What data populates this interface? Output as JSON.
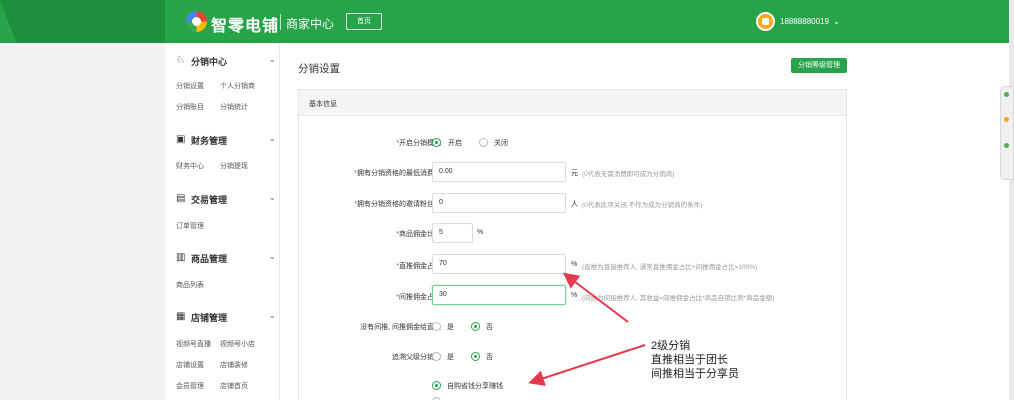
{
  "header": {
    "brand": "智零电铺",
    "subtitle": "商家中心",
    "home_label": "首页",
    "phone": "18888880019",
    "chevron": "⌄"
  },
  "sidebar": {
    "sections": [
      {
        "label": "分销中心",
        "icon": "share-icon",
        "glyph": "♘",
        "items": [
          "分销设置",
          "个人分销商",
          "分销账目",
          "分销统计"
        ]
      },
      {
        "label": "财务管理",
        "icon": "finance-icon",
        "glyph": "▣",
        "items": [
          "财务中心",
          "分销提现"
        ]
      },
      {
        "label": "交易管理",
        "icon": "order-icon",
        "glyph": "▤",
        "items": [
          "订单管理"
        ]
      },
      {
        "label": "商品管理",
        "icon": "goods-icon",
        "glyph": "▥",
        "items": [
          "商品列表"
        ]
      },
      {
        "label": "店铺管理",
        "icon": "store-icon",
        "glyph": "▦",
        "items": [
          "视频号直播",
          "视频号小店",
          "店铺设置",
          "店铺装修",
          "会员管理",
          "店铺首页"
        ]
      }
    ],
    "chevron": "⌄"
  },
  "main": {
    "title": "分销设置",
    "top_button": "分销等级管理",
    "panel_title": "基本信息",
    "form": {
      "enable_label": "开启分销模式",
      "opt_on": "开启",
      "opt_off": "关闭",
      "min_consume_label": "拥有分销资格的最低消费额",
      "min_consume_value": "0.00",
      "min_consume_unit": "元",
      "min_consume_hint": "(0代表无需消费即可成为分销商)",
      "invite_label": "拥有分销资格的邀请粉丝数",
      "invite_value": "0",
      "invite_unit": "人",
      "invite_hint": "(0代表此项关闭,不作为成为分销商的条件)",
      "commission_label": "商品佣金比例",
      "commission_value": "5",
      "commission_unit": "%",
      "direct_label": "直推佣金占比",
      "direct_value": "70",
      "direct_unit": "%",
      "direct_hint": "(直推为直接推荐人, 通常直推佣金占比+间推佣金占比=100%)",
      "indirect_label": "间推佣金占比",
      "indirect_value": "30",
      "indirect_unit": "%",
      "indirect_hint": "(间推为间接推荐人, 其收益=间推佣金占比*商品自销比例*商品金额)",
      "no_indirect_label": "没有间推, 间推佣金给直推",
      "yes": "是",
      "no": "否",
      "trace_label": "追溯父级分销商",
      "share_option": "自购省钱分享赚钱"
    },
    "annotation": [
      "2级分销",
      "直推相当于团长",
      "间推相当于分享员"
    ]
  },
  "colors": {
    "brand_green": "#27a34a",
    "required_red": "#e53935",
    "arrow_red": "#e53950"
  }
}
